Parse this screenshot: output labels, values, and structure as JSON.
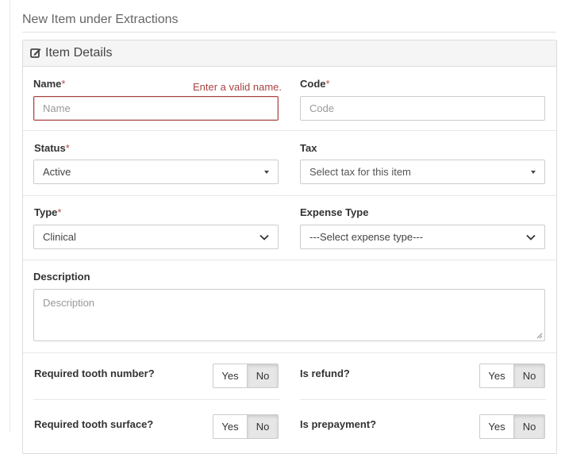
{
  "page": {
    "title": "New Item under Extractions"
  },
  "panel": {
    "heading": "Item Details"
  },
  "form": {
    "name": {
      "label": "Name",
      "required_mark": "*",
      "placeholder": "Name",
      "error": "Enter a valid name."
    },
    "code": {
      "label": "Code",
      "required_mark": "*",
      "placeholder": "Code"
    },
    "status": {
      "label": "Status",
      "required_mark": "*",
      "value": "Active"
    },
    "tax": {
      "label": "Tax",
      "value": "Select tax for this item"
    },
    "type": {
      "label": "Type",
      "required_mark": "*",
      "value": "Clinical"
    },
    "expense_type": {
      "label": "Expense Type",
      "value": "---Select expense type---"
    },
    "description": {
      "label": "Description",
      "placeholder": "Description"
    },
    "required_tooth_number": {
      "label": "Required tooth number?",
      "yes": "Yes",
      "no": "No",
      "selected": "No"
    },
    "is_refund": {
      "label": "Is refund?",
      "yes": "Yes",
      "no": "No",
      "selected": "No"
    },
    "required_tooth_surface": {
      "label": "Required tooth surface?",
      "yes": "Yes",
      "no": "No",
      "selected": "No"
    },
    "is_prepayment": {
      "label": "Is prepayment?",
      "yes": "Yes",
      "no": "No",
      "selected": "No"
    }
  },
  "colors": {
    "error": "#a94442",
    "required": "#b94a48",
    "panel_heading_bg": "#f5f5f5"
  }
}
